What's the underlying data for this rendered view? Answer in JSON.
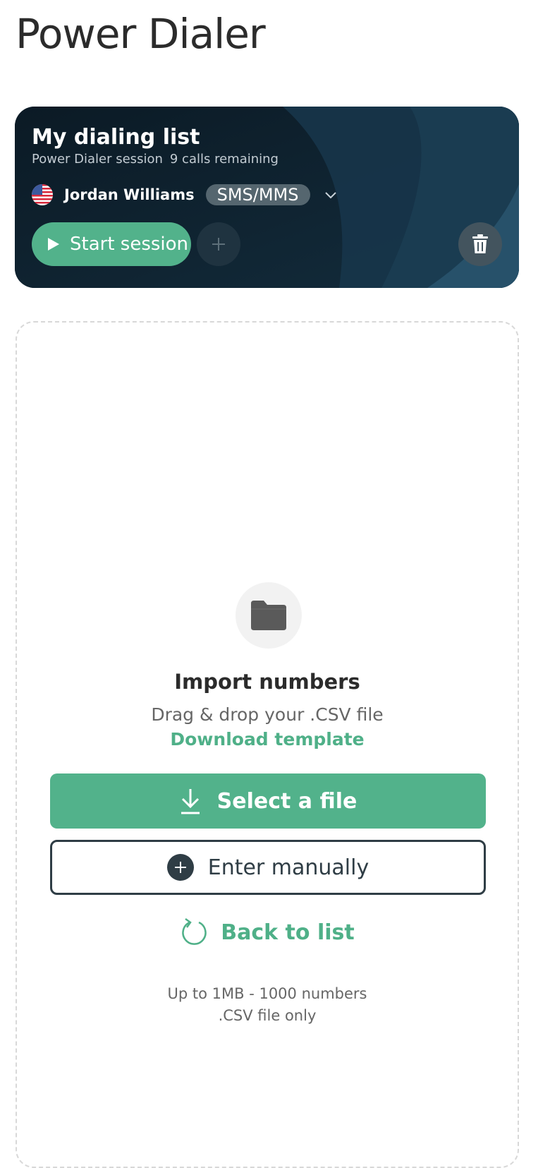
{
  "page": {
    "title": "Power Dialer"
  },
  "session": {
    "title": "My dialing list",
    "subtitle": "Power Dialer session",
    "calls_remaining": "9 calls remaining",
    "agent_name": "Jordan Williams",
    "channel": "SMS/MMS",
    "start_label": "Start session",
    "colors": {
      "card": "#0e1f2c",
      "accent": "#52b28b"
    }
  },
  "importer": {
    "icon": "folder-icon",
    "title": "Import numbers",
    "description": "Drag & drop your .CSV file",
    "template_link": "Download template",
    "select_label": "Select a file",
    "manual_label": "Enter manually",
    "back_label": "Back to list",
    "limit_size": "Up to 1MB - 1000 numbers",
    "limit_type": ".CSV file only"
  }
}
